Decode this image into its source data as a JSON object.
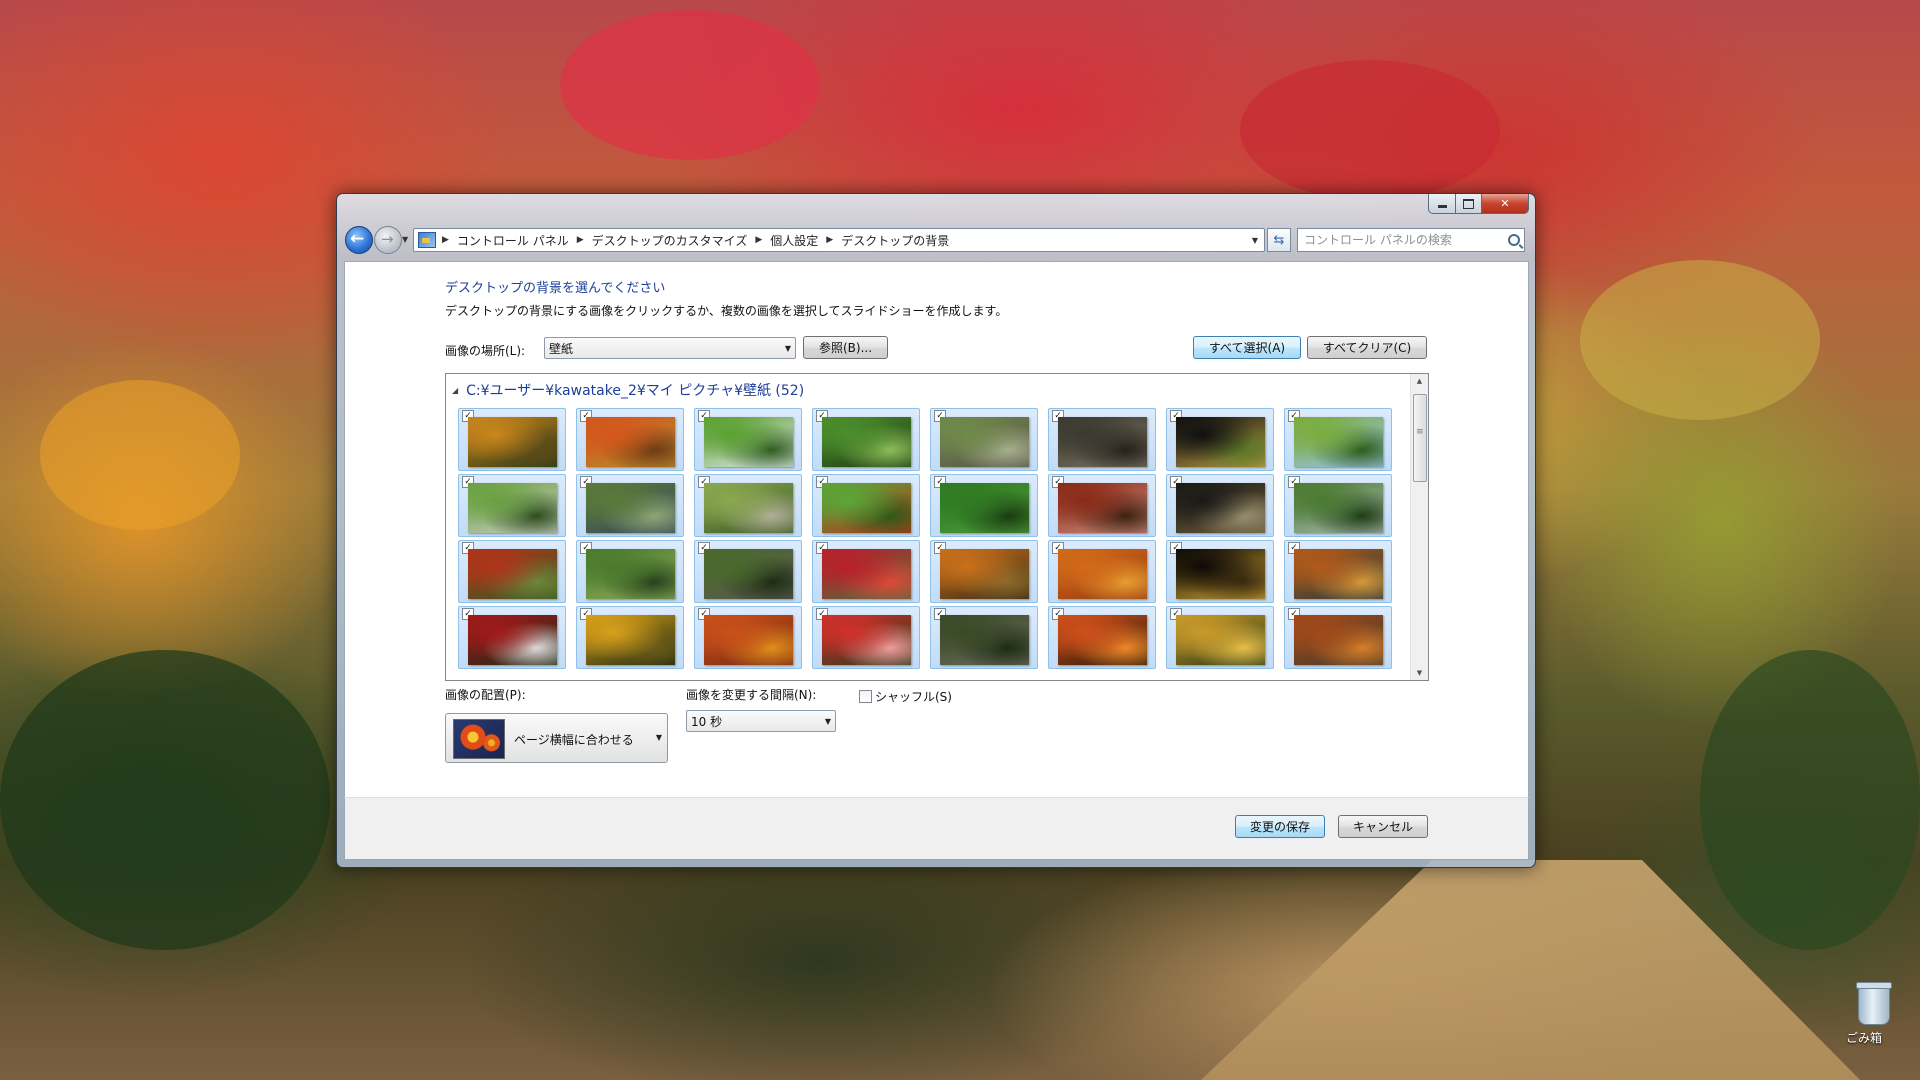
{
  "window": {
    "breadcrumbs": [
      "コントロール パネル",
      "デスクトップのカスタマイズ",
      "個人設定",
      "デスクトップの背景"
    ],
    "search_placeholder": "コントロール パネルの検索"
  },
  "content": {
    "heading": "デスクトップの背景を選んでください",
    "description": "デスクトップの背景にする画像をクリックするか、複数の画像を選択してスライドショーを作成します。",
    "location_label": "画像の場所(L):",
    "location_value": "壁紙",
    "browse_label": "参照(B)...",
    "select_all_label": "すべて選択(A)",
    "clear_all_label": "すべてクリア(C)",
    "group_header": "C:¥ユーザー¥kawatake_2¥マイ ピクチャ¥壁紙 (52)",
    "position_label": "画像の配置(P):",
    "position_value": "ページ横幅に合わせる",
    "interval_label": "画像を変更する間隔(N):",
    "interval_value": "10 秒",
    "shuffle_label": "シャッフル(S)",
    "shuffle_checked": false
  },
  "footer": {
    "save_label": "変更の保存",
    "cancel_label": "キャンセル"
  },
  "desktop": {
    "recycle_bin_label": "ごみ箱"
  },
  "thumbnails": [
    {
      "checked": true,
      "colors": [
        "#c9861c",
        "#2d3a12",
        "#5b4a1a"
      ]
    },
    {
      "checked": true,
      "colors": [
        "#d4561c",
        "#b8882a",
        "#6a3a14"
      ]
    },
    {
      "checked": true,
      "colors": [
        "#5aa030",
        "#dfe9e8",
        "#2f5a20"
      ]
    },
    {
      "checked": true,
      "colors": [
        "#4c8f2c",
        "#1e3a14",
        "#8fbf5a"
      ]
    },
    {
      "checked": true,
      "colors": [
        "#6f8a4a",
        "#5a5448",
        "#a8b090"
      ]
    },
    {
      "checked": true,
      "colors": [
        "#3a3a30",
        "#7a7060",
        "#23201a"
      ]
    },
    {
      "checked": true,
      "colors": [
        "#101010",
        "#b89a40",
        "#5a7a28"
      ]
    },
    {
      "checked": true,
      "colors": [
        "#7aac3c",
        "#9ac3e8",
        "#2a5a18"
      ]
    },
    {
      "checked": true,
      "colors": [
        "#6aa040",
        "#c9ccc4",
        "#2c4a1c"
      ]
    },
    {
      "checked": true,
      "colors": [
        "#5a7a3a",
        "#3a4a5a",
        "#90a878"
      ]
    },
    {
      "checked": true,
      "colors": [
        "#8aa850",
        "#3c5a24",
        "#b2b09a"
      ]
    },
    {
      "checked": true,
      "colors": [
        "#5aa638",
        "#b03a1a",
        "#2c5818"
      ]
    },
    {
      "checked": true,
      "colors": [
        "#2f7a22",
        "#4a9a38",
        "#1a3a10"
      ]
    },
    {
      "checked": true,
      "colors": [
        "#8a2a18",
        "#c98a7a",
        "#3a2010"
      ]
    },
    {
      "checked": true,
      "colors": [
        "#1a1a16",
        "#6a5a3a",
        "#9a9070"
      ]
    },
    {
      "checked": true,
      "colors": [
        "#4a7a30",
        "#a8b8b0",
        "#1c3a14"
      ]
    },
    {
      "checked": true,
      "colors": [
        "#b0341a",
        "#3a5a20",
        "#6a8a3a"
      ]
    },
    {
      "checked": true,
      "colors": [
        "#4a7a2c",
        "#8aaa58",
        "#24401a"
      ]
    },
    {
      "checked": true,
      "colors": [
        "#4a6a2c",
        "#5a5a50",
        "#1c2a14"
      ]
    },
    {
      "checked": true,
      "colors": [
        "#b8202a",
        "#5a6a3a",
        "#e04a3a"
      ]
    },
    {
      "checked": true,
      "colors": [
        "#c9701a",
        "#3a2a14",
        "#8a6a2a"
      ]
    },
    {
      "checked": true,
      "colors": [
        "#d26a18",
        "#9a3a12",
        "#e8a030"
      ]
    },
    {
      "checked": true,
      "colors": [
        "#0e0a06",
        "#c9a030",
        "#3a2a10"
      ]
    },
    {
      "checked": true,
      "colors": [
        "#b05a1a",
        "#2a3a3a",
        "#d89a3a"
      ]
    },
    {
      "checked": true,
      "colors": [
        "#a01a1a",
        "#1c2a14",
        "#e0e0e0"
      ]
    },
    {
      "checked": true,
      "colors": [
        "#d8a01a",
        "#1c2a10",
        "#6a5a18"
      ]
    },
    {
      "checked": true,
      "colors": [
        "#c9501a",
        "#7a2a10",
        "#e0901c"
      ]
    },
    {
      "checked": true,
      "colors": [
        "#d0302a",
        "#2a3a1a",
        "#f0a0a0"
      ]
    },
    {
      "checked": true,
      "colors": [
        "#3a4a28",
        "#6a6a5a",
        "#1c2a14"
      ]
    },
    {
      "checked": true,
      "colors": [
        "#d0501a",
        "#2a1a0a",
        "#f08a2a"
      ]
    },
    {
      "checked": true,
      "colors": [
        "#c99a2a",
        "#2a3a14",
        "#e8c04a"
      ]
    },
    {
      "checked": true,
      "colors": [
        "#a04a1a",
        "#4a3a2a",
        "#d8802a"
      ]
    }
  ]
}
